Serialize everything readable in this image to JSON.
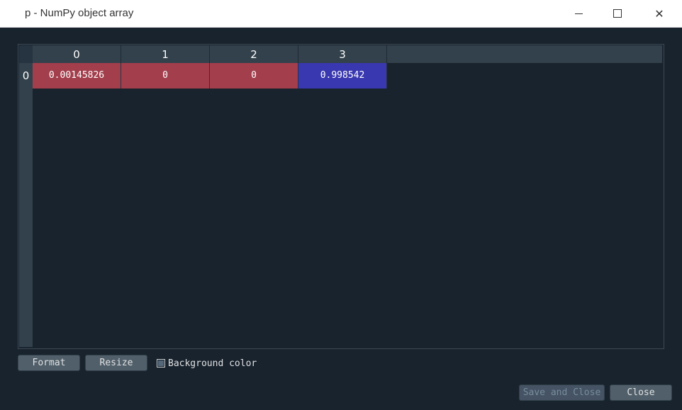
{
  "window": {
    "title": "p - NumPy object array",
    "minimize_icon": "minimize-icon",
    "maximize_icon": "maximize-icon",
    "close_icon": "close-icon",
    "close_glyph": "✕"
  },
  "table": {
    "columns": [
      "0",
      "1",
      "2",
      "3"
    ],
    "rows": [
      {
        "label": "0",
        "cells": [
          {
            "value": "0.00145826",
            "color": "#a33e4c"
          },
          {
            "value": "0",
            "color": "#a33e4c"
          },
          {
            "value": "0",
            "color": "#a33e4c"
          },
          {
            "value": "0.998542",
            "color": "#3938b0"
          }
        ]
      }
    ]
  },
  "controls": {
    "format_label": "Format",
    "resize_label": "Resize",
    "background_color_label": "Background color",
    "background_color_checked": true
  },
  "dialog_buttons": {
    "save_and_close_label": "Save and Close",
    "close_label": "Close"
  }
}
